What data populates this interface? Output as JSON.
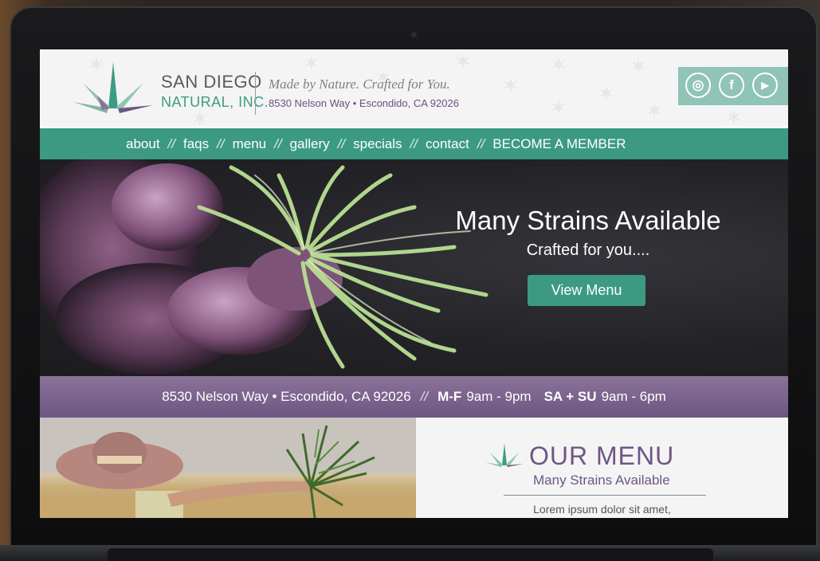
{
  "header": {
    "logo_line1": "SAN DIEGO",
    "logo_line2": "NATURAL, INC.",
    "tagline": "Made by Nature. Crafted for You.",
    "address": "8530 Nelson Way • Escondido, CA 92026",
    "social": [
      {
        "icon": "instagram-icon",
        "glyph": "◎"
      },
      {
        "icon": "facebook-icon",
        "glyph": "f"
      },
      {
        "icon": "youtube-icon",
        "glyph": "▶"
      }
    ]
  },
  "nav": {
    "items": [
      "about",
      "faqs",
      "menu",
      "gallery",
      "specials",
      "contact",
      "BECOME A MEMBER"
    ],
    "separator": "//"
  },
  "hero": {
    "title": "Many Strains Available",
    "subtitle": "Crafted for you....",
    "button": "View Menu"
  },
  "info_bar": {
    "address": "8530 Nelson Way • Escondido, CA 92026",
    "separator": "//",
    "weekday_label": "M-F",
    "weekday_hours": "9am - 9pm",
    "weekend_label": "SA + SU",
    "weekend_hours": "9am - 6pm"
  },
  "menu_section": {
    "title": "OUR MENU",
    "subtitle": "Many Strains Available",
    "body": "Lorem ipsum dolor sit amet,"
  },
  "colors": {
    "teal": "#3c9a82",
    "purple": "#6e5684",
    "header_bg": "#f4f4f4"
  }
}
